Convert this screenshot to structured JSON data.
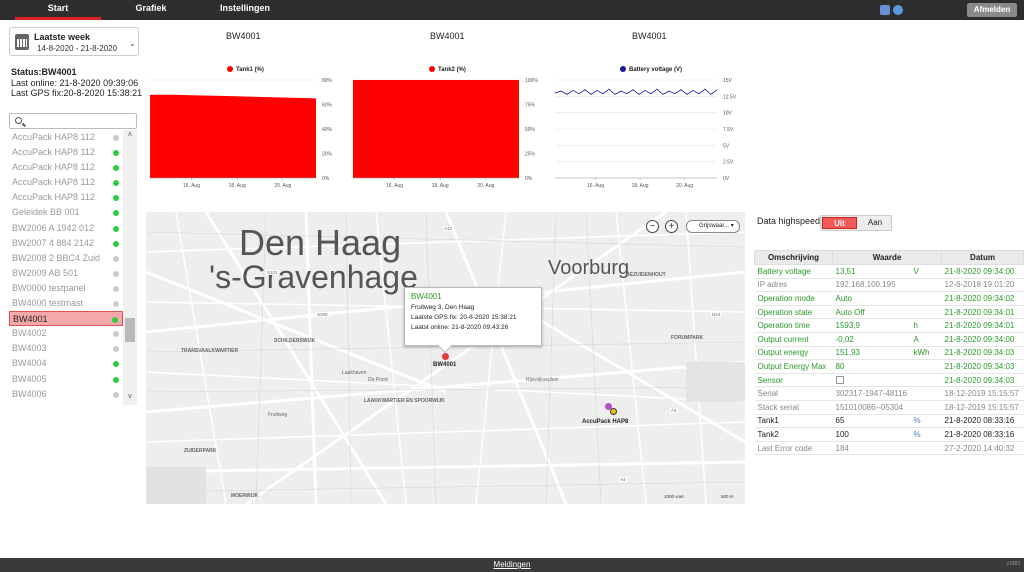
{
  "nav": {
    "tabs": [
      {
        "label": "Start"
      },
      {
        "label": "Grafiek"
      },
      {
        "label": "Instellingen"
      }
    ],
    "logout_label": "Afmelden"
  },
  "period": {
    "title": "Laatste week",
    "range": "14-8-2020 - 21-8-2020"
  },
  "status": {
    "title": "Status:BW4001",
    "last_online": "Last online:  21-8-2020 09:39:06",
    "last_gps": "Last GPS fix:20-8-2020 15:38:21"
  },
  "search": {
    "placeholder": ""
  },
  "vehicle_list": [
    {
      "name": "AccuPack HAP8 112",
      "status": "grey"
    },
    {
      "name": "AccuPack HAP8 112",
      "status": "green"
    },
    {
      "name": "AccuPack HAP8 112",
      "status": "green"
    },
    {
      "name": "AccuPack HAP8 112",
      "status": "green"
    },
    {
      "name": "AccuPack HAP8 112",
      "status": "green"
    },
    {
      "name": "Geleidek BB 001",
      "status": "green"
    },
    {
      "name": "BW2006 A 1942 012",
      "status": "green"
    },
    {
      "name": "BW2007 4 884 2142",
      "status": "green"
    },
    {
      "name": "BW2008 2 BBC4 Zuid",
      "status": "grey"
    },
    {
      "name": "BW2009 AB 501",
      "status": "grey"
    },
    {
      "name": "BW0000 testpanel",
      "status": "grey"
    },
    {
      "name": "BW4000 testmast",
      "status": "grey"
    },
    {
      "name": "BW4001",
      "status": "green",
      "selected": true
    },
    {
      "name": "BW4002",
      "status": "grey"
    },
    {
      "name": "BW4003",
      "status": "grey"
    },
    {
      "name": "BW4004",
      "status": "green"
    },
    {
      "name": "BW4005",
      "status": "green"
    },
    {
      "name": "BW4006",
      "status": "grey"
    }
  ],
  "charts": {
    "vehicle_title": "BW4001",
    "tank1_legend": "Tank1 (%)",
    "tank2_legend": "Tank2 (%)",
    "battery_legend": "Battery voltage (V)",
    "x_ticks": [
      "16. Aug",
      "18. Aug",
      "20. Aug"
    ],
    "tank1_yticks": [
      "80%",
      "60%",
      "40%",
      "20%",
      "0%"
    ],
    "tank2_yticks": [
      "100%",
      "75%",
      "50%",
      "25%",
      "0%"
    ],
    "battery_yticks": [
      "15V",
      "12.5V",
      "10V",
      "7.5V",
      "5V",
      "2.5V",
      "0V"
    ],
    "colors": {
      "tank": "#ff0000",
      "battery": "#1a1aa6"
    }
  },
  "chart_data": [
    {
      "type": "area",
      "title": "BW4001",
      "series": [
        {
          "name": "Tank1 (%)",
          "values": [
            68,
            68,
            67.5,
            67,
            66.5,
            66,
            65.5,
            65
          ]
        }
      ],
      "ylim": [
        0,
        80
      ]
    },
    {
      "type": "area",
      "title": "BW4001",
      "series": [
        {
          "name": "Tank2 (%)",
          "values": [
            100,
            100,
            100,
            100,
            100,
            100,
            100,
            100
          ]
        }
      ],
      "ylim": [
        0,
        100
      ]
    },
    {
      "type": "line",
      "title": "BW4001",
      "series": [
        {
          "name": "Battery voltage (V)",
          "values": [
            13.0,
            13.3,
            12.8,
            13.4,
            12.9,
            13.5,
            12.8,
            13.4,
            12.9,
            13.6,
            12.8,
            13.3,
            12.9,
            13.5,
            12.8,
            13.4,
            12.9,
            13.6,
            12.8,
            13.3,
            12.9,
            13.5,
            12.8,
            13.4,
            12.9,
            13.6,
            12.8,
            13.5
          ]
        }
      ],
      "ylim": [
        0,
        15
      ]
    }
  ],
  "map": {
    "city1": "Den Haag",
    "city2": "'s-Gravenhage",
    "city3": "Voorburg",
    "districts": [
      "TRANSVAALKWARTIER",
      "SCHILDERSWIJK",
      "LAAKKWARTIER EN SPOORWIJK",
      "ZUIDERPARK",
      "MOERWIJK",
      "FORUMPARK",
      "BEZUIDENHOUT"
    ],
    "streets": [
      "De Poort",
      "Laakhaven",
      "Fruitweg",
      "Rijswijkseplein"
    ],
    "road_labels": [
      "A12",
      "A4",
      "A4",
      "N44",
      "S100",
      "S101"
    ],
    "maptype_label": "Grijswaar...",
    "zoom_out": "−",
    "zoom_in": "+",
    "marker1_label": "BW4001",
    "marker2_label": "AccuPack HAP8",
    "scale_1": "1000 voet",
    "scale_2": "500 m",
    "popup": {
      "title": "BW4001",
      "address": "Fruitweg 3, Den Haag",
      "gps_fix": "Laatste GPS fix: 20-8-2020 15:38:21",
      "last_online": "Laatst online:    21-8-2020 09:43:26"
    }
  },
  "highspeed": {
    "label": "Data highspeed",
    "off_label": "Uit",
    "on_label": "Aan"
  },
  "info_table": {
    "headers": [
      "Omschrijving",
      "Waarde",
      "Datum"
    ],
    "rows": [
      {
        "desc": "Battery voltage",
        "value": "13,51",
        "unit": "V",
        "date": "21-8-2020 09:34:00",
        "style": "g"
      },
      {
        "desc": "IP adres",
        "value": "192.168.100.195",
        "unit": "",
        "date": "12-6-2018 19:01:20",
        "style": "gr"
      },
      {
        "desc": "Operation mode",
        "value": "Auto",
        "unit": "",
        "date": "21-8-2020 09:34:02",
        "style": "g"
      },
      {
        "desc": "Operation state",
        "value": "Auto Off",
        "unit": "",
        "date": "21-8-2020 09:34:01",
        "style": "g"
      },
      {
        "desc": "Operation time",
        "value": "1593,9",
        "unit": "h",
        "date": "21-8-2020 09:34:01",
        "style": "g"
      },
      {
        "desc": "Output current",
        "value": "-0,02",
        "unit": "A",
        "date": "21-8-2020 09:34:00",
        "style": "g"
      },
      {
        "desc": "Output energy",
        "value": "151,93",
        "unit": "kWh",
        "date": "21-8-2020 09:34:03",
        "style": "g"
      },
      {
        "desc": "Output Energy Max",
        "value": "80",
        "unit": "",
        "date": "21-8-2020 09:34:03",
        "style": "g"
      },
      {
        "desc": "Sensor",
        "value": "",
        "unit": "",
        "date": "21-8-2020 09:34:03",
        "style": "g",
        "checkbox": true
      },
      {
        "desc": "Serial",
        "value": "302317-1947-48116",
        "unit": "",
        "date": "18-12-2019 15:15:57",
        "style": "gr"
      },
      {
        "desc": "Stack serial",
        "value": "151010086--05304",
        "unit": "",
        "date": "18-12-2019 15:15:57",
        "style": "gr"
      },
      {
        "desc": "Tank1",
        "value": "65",
        "unit": "%",
        "date": "21-8-2020 08:33:16",
        "style": "n"
      },
      {
        "desc": "Tank2",
        "value": "100",
        "unit": "%",
        "date": "21-8-2020 08:33:16",
        "style": "n"
      },
      {
        "desc": "Last Error code",
        "value": "184",
        "unit": "",
        "date": "27-2-2020 14:40:32",
        "style": "gr"
      }
    ]
  },
  "footer": {
    "link": "Meldingen",
    "version": "v1083"
  }
}
